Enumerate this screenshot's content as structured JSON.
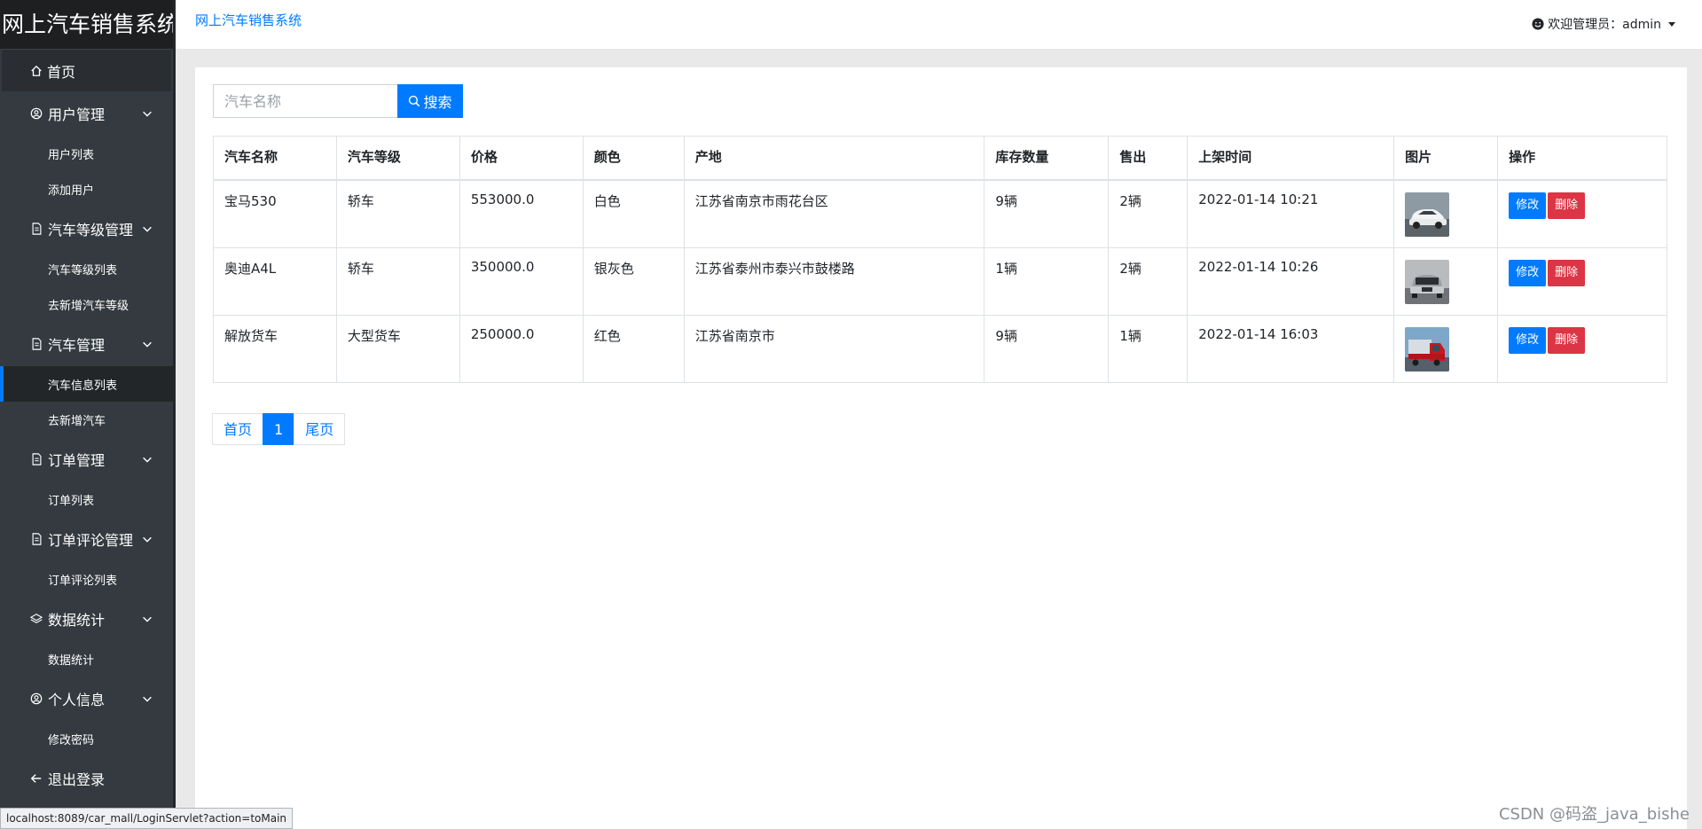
{
  "sidebar": {
    "brand": "网上汽车销售系统",
    "home": "首页",
    "groups": [
      {
        "label": "用户管理",
        "icon": "user-circle-icon",
        "items": [
          "用户列表",
          "添加用户"
        ]
      },
      {
        "label": "汽车等级管理",
        "icon": "document-icon",
        "items": [
          "汽车等级列表",
          "去新增汽车等级"
        ]
      },
      {
        "label": "汽车管理",
        "icon": "document-icon",
        "items": [
          "汽车信息列表",
          "去新增汽车"
        ]
      },
      {
        "label": "订单管理",
        "icon": "document-icon",
        "items": [
          "订单列表"
        ]
      },
      {
        "label": "订单评论管理",
        "icon": "document-icon",
        "items": [
          "订单评论列表"
        ]
      },
      {
        "label": "数据统计",
        "icon": "layers-icon",
        "items": [
          "数据统计"
        ]
      },
      {
        "label": "个人信息",
        "icon": "user-circle-icon",
        "items": [
          "修改密码"
        ]
      }
    ],
    "active_item": "汽车信息列表",
    "logout": "退出登录"
  },
  "topbar": {
    "system_name": "网上汽车销售系统",
    "welcome": "欢迎管理员：admin"
  },
  "search": {
    "placeholder": "汽车名称",
    "button_label": "搜索"
  },
  "table": {
    "headers": [
      "汽车名称",
      "汽车等级",
      "价格",
      "颜色",
      "产地",
      "库存数量",
      "售出",
      "上架时间",
      "图片",
      "操作"
    ],
    "rows": [
      {
        "name": "宝马530",
        "level": "轿车",
        "price": "553000.0",
        "color": "白色",
        "origin": "江苏省南京市雨花台区",
        "stock": "9辆",
        "sold": "2辆",
        "time": "2022-01-14 10:21",
        "image": "white-sedan",
        "edit": "修改",
        "delete": "删除"
      },
      {
        "name": "奥迪A4L",
        "level": "轿车",
        "price": "350000.0",
        "color": "银灰色",
        "origin": "江苏省泰州市泰兴市鼓楼路",
        "stock": "1辆",
        "sold": "2辆",
        "time": "2022-01-14 10:26",
        "image": "silver-sedan",
        "edit": "修改",
        "delete": "删除"
      },
      {
        "name": "解放货车",
        "level": "大型货车",
        "price": "250000.0",
        "color": "红色",
        "origin": "江苏省南京市",
        "stock": "9辆",
        "sold": "1辆",
        "time": "2022-01-14 16:03",
        "image": "red-truck",
        "edit": "修改",
        "delete": "删除"
      }
    ]
  },
  "pagination": {
    "first": "首页",
    "current": "1",
    "last": "尾页"
  },
  "statusbar": {
    "url": "localhost:8089/car_mall/LoginServlet?action=toMain"
  },
  "watermark": "CSDN @码盗_java_bishe",
  "colors": {
    "sidebar_bg": "#343a40",
    "brand_bg": "#1d1f21",
    "primary": "#007bff",
    "danger": "#dc3545"
  }
}
